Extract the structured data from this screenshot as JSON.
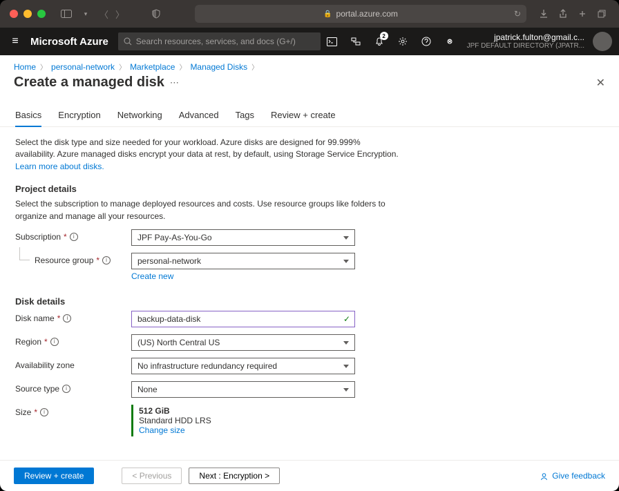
{
  "browser": {
    "url": "portal.azure.com"
  },
  "azure": {
    "brand": "Microsoft Azure",
    "search_placeholder": "Search resources, services, and docs (G+/)",
    "notif_count": "2",
    "account_email": "jpatrick.fulton@gmail.c...",
    "account_dir": "JPF DEFAULT DIRECTORY (JPATR..."
  },
  "breadcrumb": {
    "items": [
      "Home",
      "personal-network",
      "Marketplace",
      "Managed Disks"
    ]
  },
  "page": {
    "title": "Create a managed disk",
    "intro": "Select the disk type and size needed for your workload. Azure disks are designed for 99.999% availability. Azure managed disks encrypt your data at rest, by default, using Storage Service Encryption.",
    "learn_more": "Learn more about disks."
  },
  "tabs": [
    "Basics",
    "Encryption",
    "Networking",
    "Advanced",
    "Tags",
    "Review + create"
  ],
  "project": {
    "heading": "Project details",
    "desc": "Select the subscription to manage deployed resources and costs. Use resource groups like folders to organize and manage all your resources.",
    "subscription_label": "Subscription",
    "subscription_value": "JPF Pay-As-You-Go",
    "rg_label": "Resource group",
    "rg_value": "personal-network",
    "create_new": "Create new"
  },
  "disk": {
    "heading": "Disk details",
    "name_label": "Disk name",
    "name_value": "backup-data-disk",
    "region_label": "Region",
    "region_value": "(US) North Central US",
    "az_label": "Availability zone",
    "az_value": "No infrastructure redundancy required",
    "source_label": "Source type",
    "source_value": "None",
    "size_label": "Size",
    "size_value": "512 GiB",
    "size_sku": "Standard HDD LRS",
    "change_size": "Change size"
  },
  "footer": {
    "review": "Review + create",
    "prev": "< Previous",
    "next": "Next : Encryption >",
    "feedback": "Give feedback"
  }
}
